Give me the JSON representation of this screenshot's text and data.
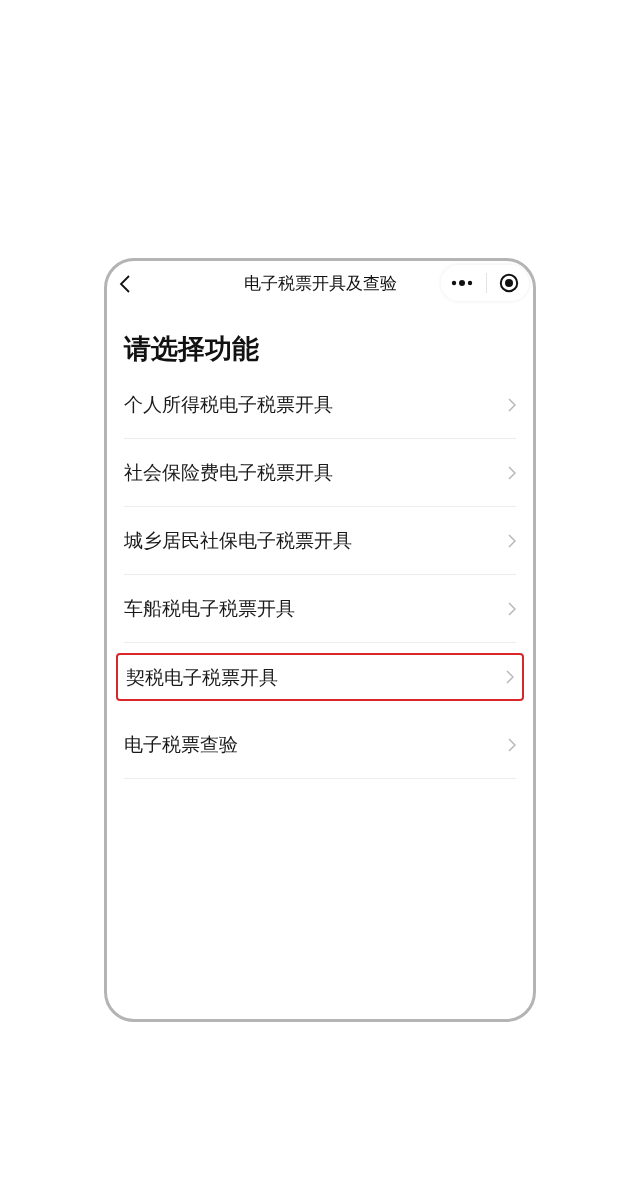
{
  "nav_bar": {
    "title": "电子税票开具及查验"
  },
  "heading": "请选择功能",
  "items": [
    {
      "label": "个人所得税电子税票开具",
      "highlighted": false
    },
    {
      "label": "社会保险费电子税票开具",
      "highlighted": false
    },
    {
      "label": "城乡居民社保电子税票开具",
      "highlighted": false
    },
    {
      "label": "车船税电子税票开具",
      "highlighted": false
    },
    {
      "label": "契税电子税票开具",
      "highlighted": true
    },
    {
      "label": "电子税票查验",
      "highlighted": false
    }
  ]
}
